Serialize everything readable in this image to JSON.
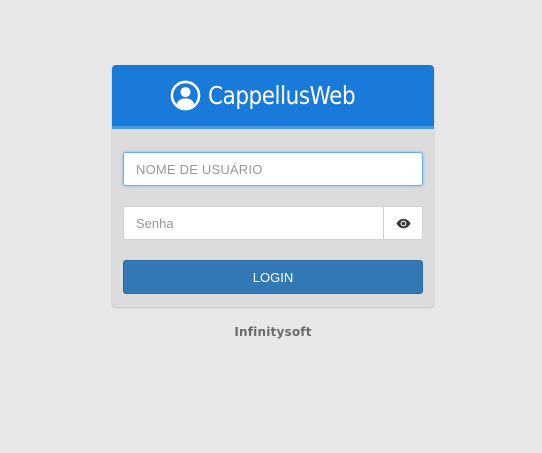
{
  "header": {
    "title": "CappellusWeb",
    "icon": "user-circle-icon"
  },
  "form": {
    "username_placeholder": "NOME DE USUÁRIO",
    "username_value": "",
    "password_placeholder": "Senha",
    "password_value": "",
    "toggle_icon": "eye-icon",
    "login_label": "LOGIN"
  },
  "footer": {
    "text": "Infinitysoft"
  },
  "colors": {
    "header_bg": "#1a7ad9",
    "button_bg": "#3278b5",
    "card_bg": "#dcdcdc",
    "page_bg": "#e8e8e8"
  }
}
